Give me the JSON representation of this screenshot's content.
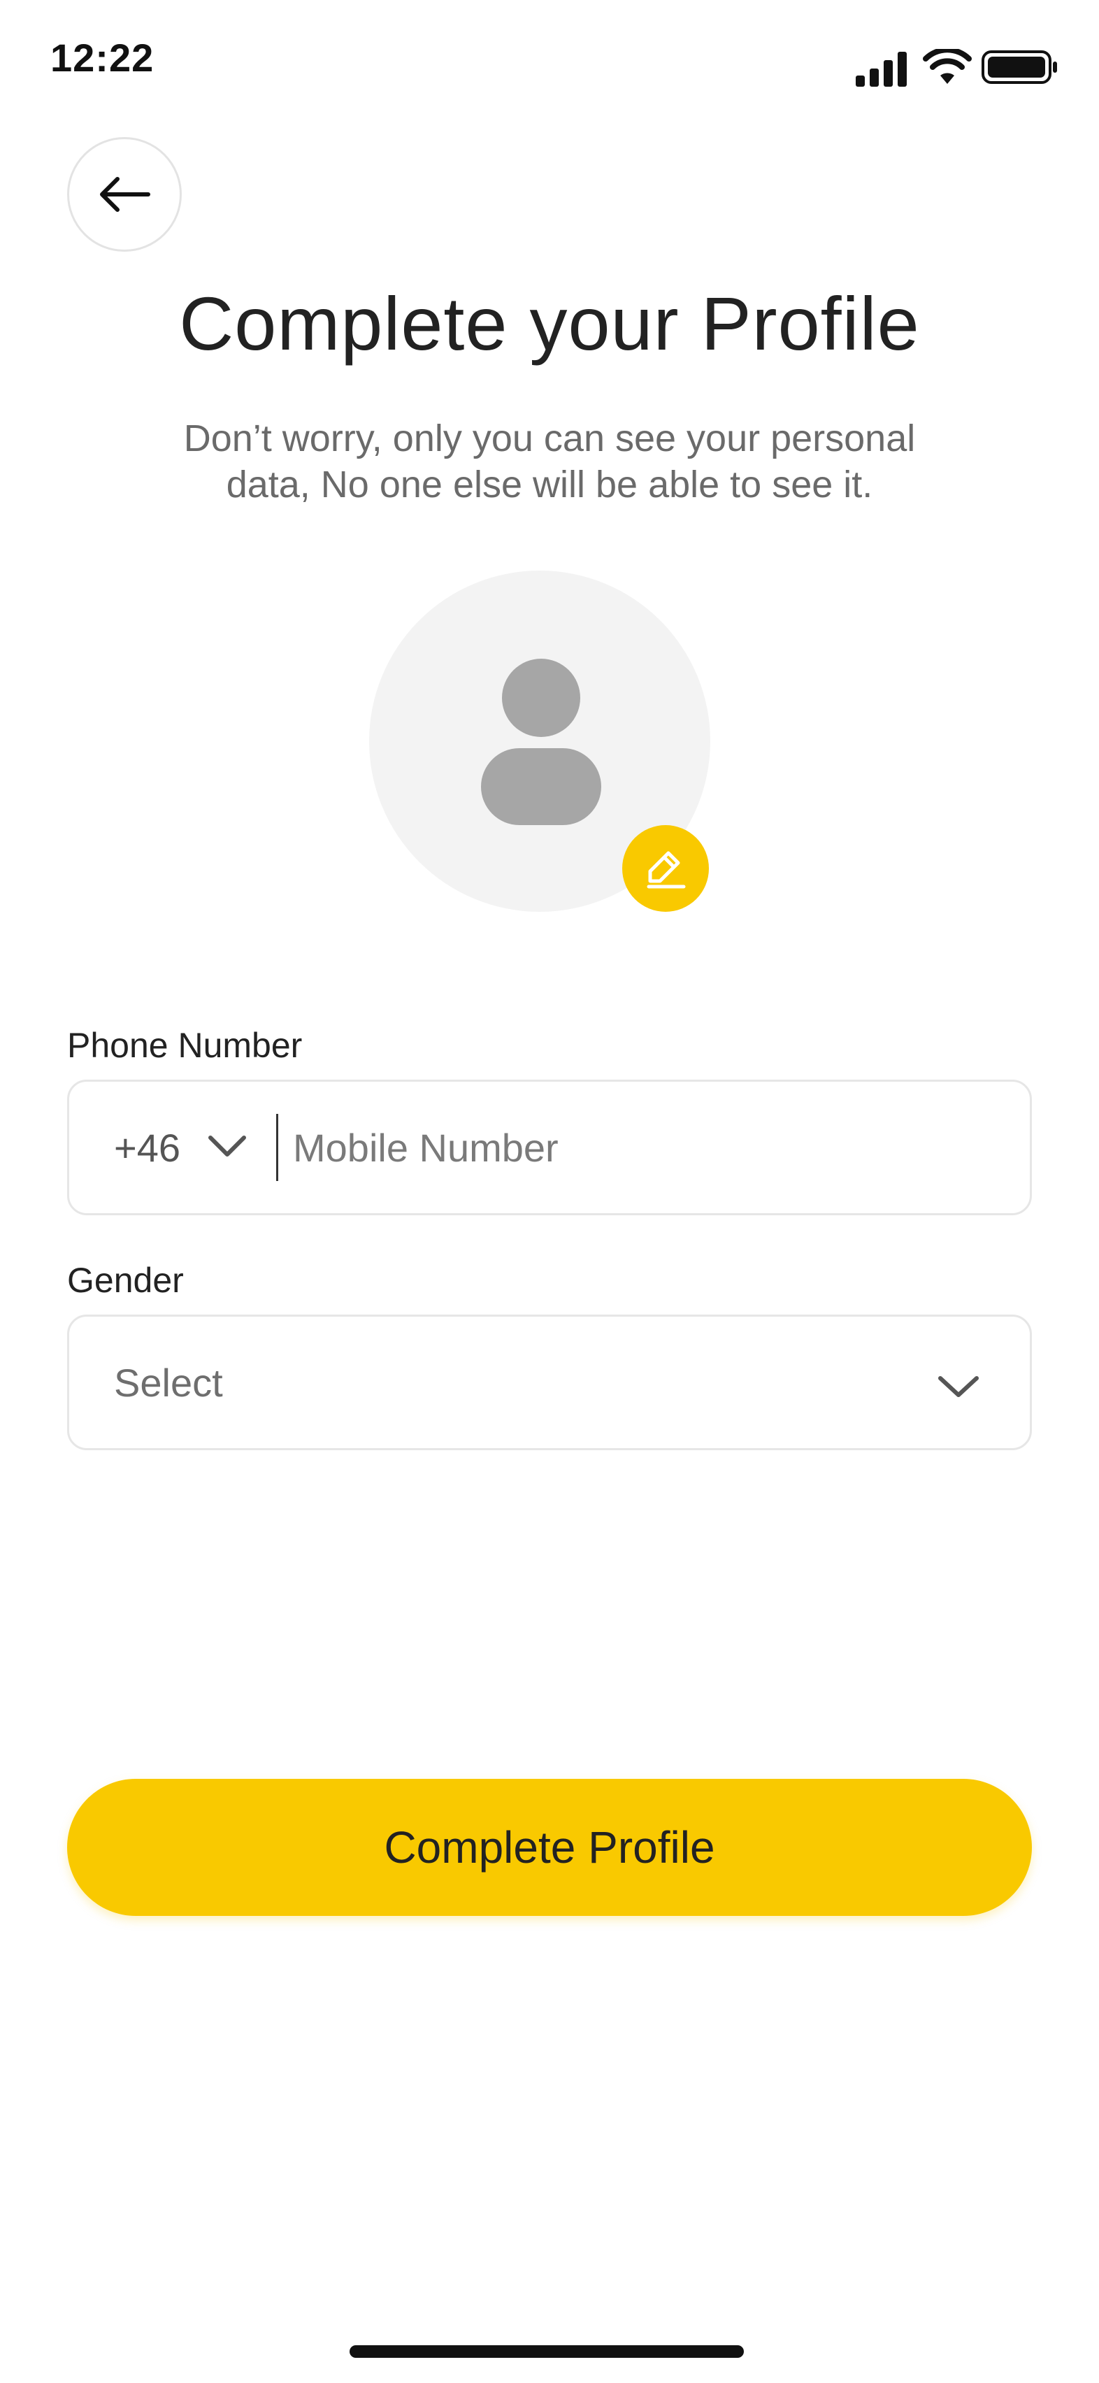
{
  "status_bar": {
    "time": "12:22",
    "icons": [
      "signal-icon",
      "wifi-icon",
      "battery-icon"
    ]
  },
  "header": {
    "back_icon": "arrow-left-icon",
    "title": "Complete your Profile",
    "subtitle": "Don’t worry, only you can see your personal data, No one else will be able to see it."
  },
  "avatar": {
    "placeholder_icon": "user-placeholder-icon",
    "edit_icon": "pencil-icon"
  },
  "form": {
    "phone": {
      "label": "Phone Number",
      "country_code": "+46",
      "value": "",
      "placeholder": "Mobile Number"
    },
    "gender": {
      "label": "Gender",
      "selected": "Select"
    }
  },
  "actions": {
    "submit_label": "Complete Profile"
  },
  "colors": {
    "accent": "#f9c900",
    "text_primary": "#222222",
    "text_secondary": "#6a6a6a",
    "border": "#e6e6e6",
    "avatar_bg": "#f3f3f3"
  }
}
